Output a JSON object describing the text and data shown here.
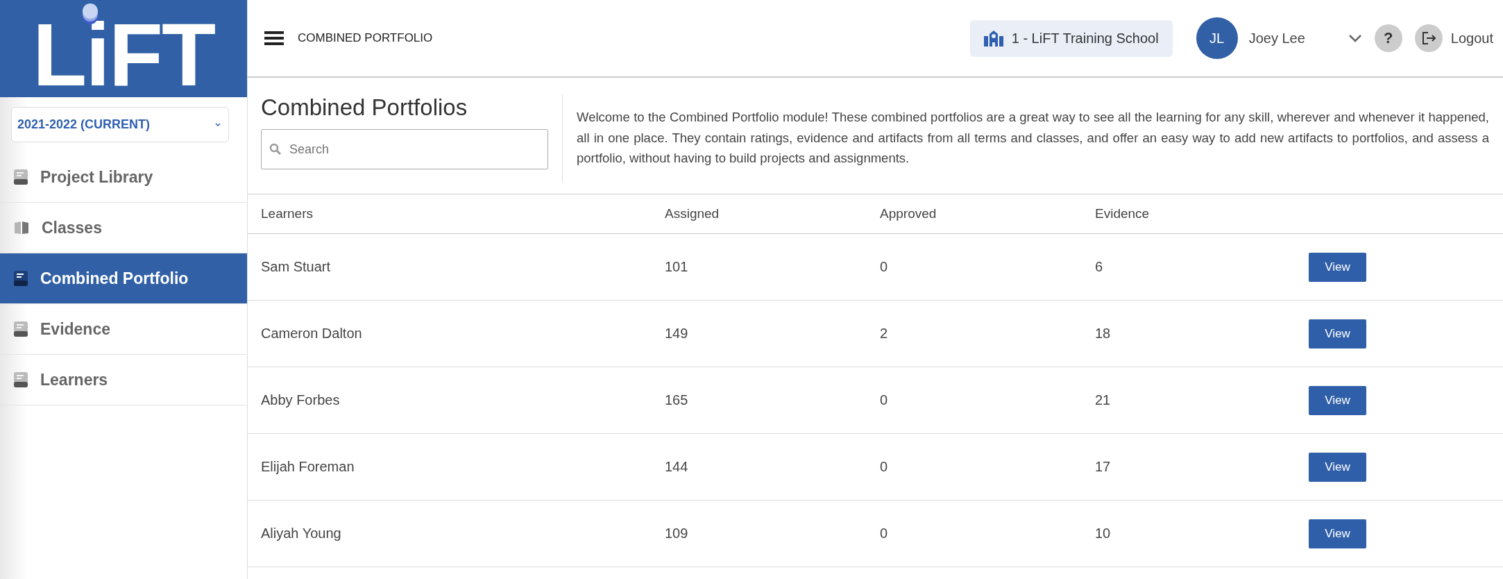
{
  "logo": {
    "text": "LiFT"
  },
  "year_select": {
    "value": "2021-2022 (CURRENT)"
  },
  "sidebar": {
    "items": [
      {
        "label": "Project Library",
        "selected": false
      },
      {
        "label": "Classes",
        "selected": false
      },
      {
        "label": "Combined Portfolio",
        "selected": true
      },
      {
        "label": "Evidence",
        "selected": false
      },
      {
        "label": "Learners",
        "selected": false
      }
    ]
  },
  "header": {
    "title": "COMBINED PORTFOLIO",
    "school": "1 - LiFT Training School",
    "user_initials": "JL",
    "user_name": "Joey Lee",
    "help": "?",
    "logout": "Logout"
  },
  "page": {
    "title": "Combined Portfolios",
    "search": {
      "placeholder": "Search"
    },
    "description": "Welcome to the Combined Portfolio module! These combined portfolios are a great way to see all the learning for any skill, wherever and whenever it happened, all in one place. They contain ratings, evidence and artifacts from all terms and classes, and offer an easy way to add new artifacts to portfolios, and assess a portfolio, without having to build projects and assignments."
  },
  "table": {
    "columns": [
      "Learners",
      "Assigned",
      "Approved",
      "Evidence"
    ],
    "rows": [
      {
        "learner": "Sam Stuart",
        "assigned": "101",
        "approved": "0",
        "evidence": "6",
        "action": "View"
      },
      {
        "learner": "Cameron Dalton",
        "assigned": "149",
        "approved": "2",
        "evidence": "18",
        "action": "View"
      },
      {
        "learner": "Abby Forbes",
        "assigned": "165",
        "approved": "0",
        "evidence": "21",
        "action": "View"
      },
      {
        "learner": "Elijah Foreman",
        "assigned": "144",
        "approved": "0",
        "evidence": "17",
        "action": "View"
      },
      {
        "learner": "Aliyah Young",
        "assigned": "109",
        "approved": "0",
        "evidence": "10",
        "action": "View"
      }
    ]
  }
}
